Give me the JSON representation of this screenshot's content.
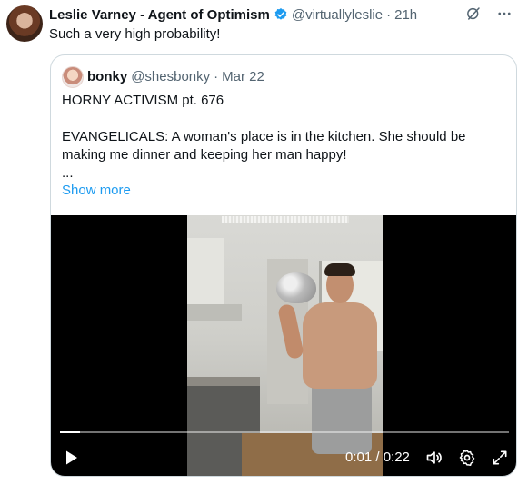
{
  "tweet": {
    "author_name": "Leslie Varney - Agent of Optimism",
    "handle": "@virtuallyleslie",
    "separator": "·",
    "time": "21h",
    "text": "Such a very high probability!"
  },
  "quote": {
    "author_name": "bonky",
    "handle": "@shesbonky",
    "separator": "·",
    "date": "Mar 22",
    "lines": [
      "HORNY ACTIVISM pt. 676",
      "",
      "EVANGELICALS: A woman's place is in the kitchen. She should be",
      "making me dinner and keeping her man happy!",
      "..."
    ],
    "show_more": "Show more"
  },
  "video": {
    "time_text": "0:01 / 0:22",
    "progress": 0.045
  },
  "icons": {
    "verified": "verified-badge-icon",
    "grok": "grok-icon",
    "more": "more-icon",
    "play": "play-icon",
    "volume": "volume-icon",
    "settings": "settings-gear-icon",
    "fullscreen": "fullscreen-icon"
  },
  "colors": {
    "verified_blue": "#1d9bf0",
    "link_blue": "#1d9bf0",
    "secondary_text": "#536471"
  }
}
